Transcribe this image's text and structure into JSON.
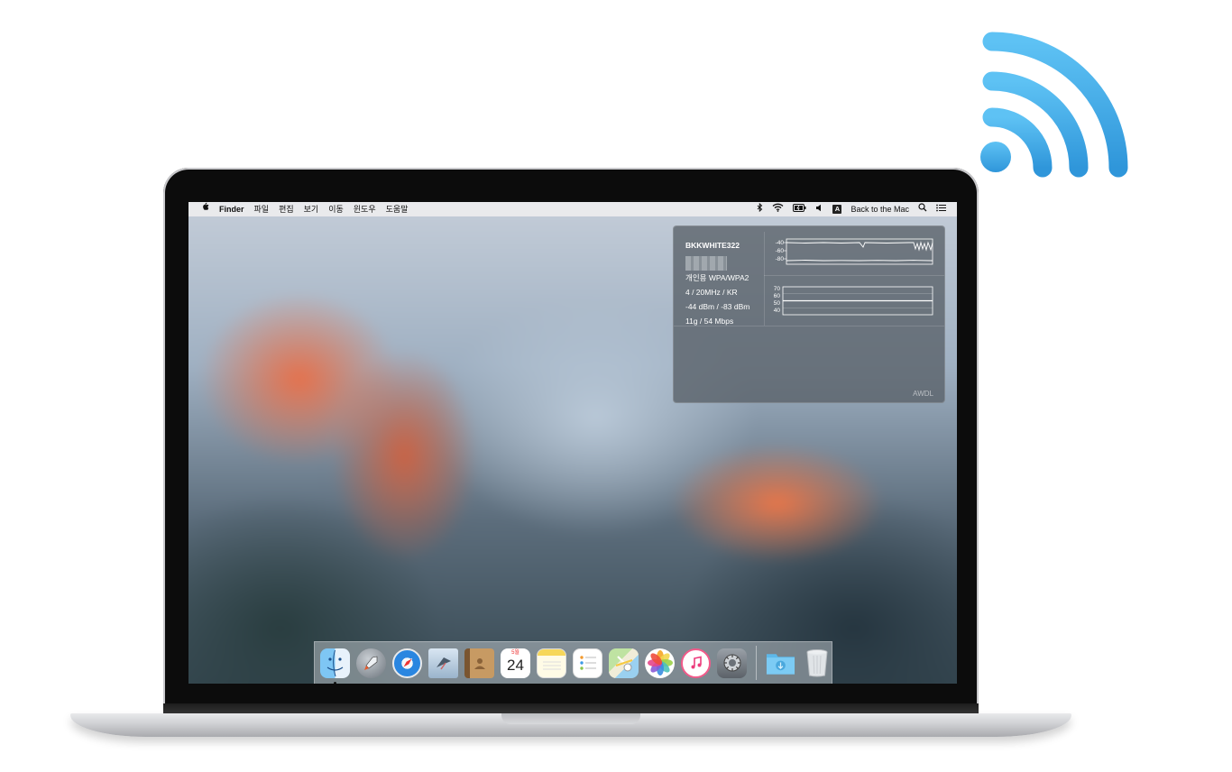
{
  "menubar": {
    "apple": "",
    "app_name": "Finder",
    "menus": [
      "파일",
      "편집",
      "보기",
      "이동",
      "윈도우",
      "도움말"
    ],
    "input_source": "A",
    "user_name": "Back to the Mac"
  },
  "wifi_popover": {
    "ssid": "BKKWHITE322",
    "security": "개인용 WPA/WPA2",
    "channel": "4 / 20MHz / KR",
    "signal_noise": "-44 dBm / -83 dBm",
    "mode_rate": "11g / 54 Mbps",
    "signal_graph_ticks": [
      "-40",
      "-60",
      "-80"
    ],
    "rate_graph_ticks": [
      "70",
      "60",
      "50",
      "40"
    ],
    "footer": "AWDL"
  },
  "dock": {
    "calendar_month": "5월",
    "calendar_day": "24",
    "items": [
      "finder-icon",
      "launchpad-icon",
      "safari-icon",
      "mail-icon",
      "contacts-icon",
      "calendar-icon",
      "notes-icon",
      "reminders-icon",
      "maps-icon",
      "photos-icon",
      "itunes-icon",
      "system-preferences-icon",
      "downloads-folder-icon",
      "trash-icon"
    ]
  },
  "colors": {
    "wifi_badge": "#4db0ea",
    "accent": "#1a8cf0"
  }
}
